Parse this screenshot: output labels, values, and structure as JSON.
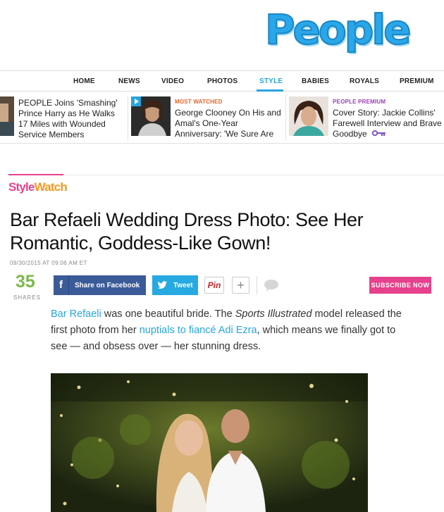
{
  "logo": {
    "text": "People"
  },
  "nav": {
    "items": [
      {
        "label": "HOME",
        "active": false
      },
      {
        "label": "NEWS",
        "active": false
      },
      {
        "label": "VIDEO",
        "active": false
      },
      {
        "label": "PHOTOS",
        "active": false
      },
      {
        "label": "STYLE",
        "active": true
      },
      {
        "label": "BABIES",
        "active": false
      },
      {
        "label": "ROYALS",
        "active": false
      },
      {
        "label": "PREMIUM",
        "active": false
      }
    ]
  },
  "strip": [
    {
      "kicker": "",
      "text": "PEOPLE Joins 'Smashing' Prince Harry as He Walks 17 Miles with Wounded Service Members"
    },
    {
      "kicker": "MOST WATCHED",
      "kicker_color": "#e8632b",
      "text": "George Clooney On His and Amal's One-Year Anniversary: 'We Sure Are Having Fun'",
      "icon": "play-icon"
    },
    {
      "kicker": "PEOPLE PREMIUM",
      "kicker_color": "#9b3fb8",
      "text": "Cover Story: Jackie Collins' Farewell Interview and Brave Goodbye",
      "icon": "key-icon"
    }
  ],
  "section": {
    "style": "Style",
    "watch": "Watch"
  },
  "article": {
    "headline": "Bar Refaeli Wedding Dress Photo: See Her Romantic, Goddess-Like Gown!",
    "dateline": "09/30/2015 AT 09:06 AM ET",
    "body": {
      "link1": "Bar Refaeli",
      "t1": " was one beautiful bride. The ",
      "em": "Sports Illustrated",
      "t2": " model released the first photo from her ",
      "link2": "nuptials to fiancé Adi Ezra",
      "t3": ", which means we finally got to see — and obsess over — her stunning dress."
    }
  },
  "share": {
    "count": "35",
    "count_label": "SHARES",
    "facebook": "Share on Facebook",
    "twitter": "Tweet",
    "pinterest": "Pin",
    "more": "+",
    "subscribe": "SUBSCRIBE NOW"
  },
  "colors": {
    "accent": "#27a4de",
    "pink": "#e6418c",
    "orange": "#f29a22",
    "facebook": "#3b5a98",
    "twitter": "#27a9e1",
    "shares": "#7db84a"
  }
}
